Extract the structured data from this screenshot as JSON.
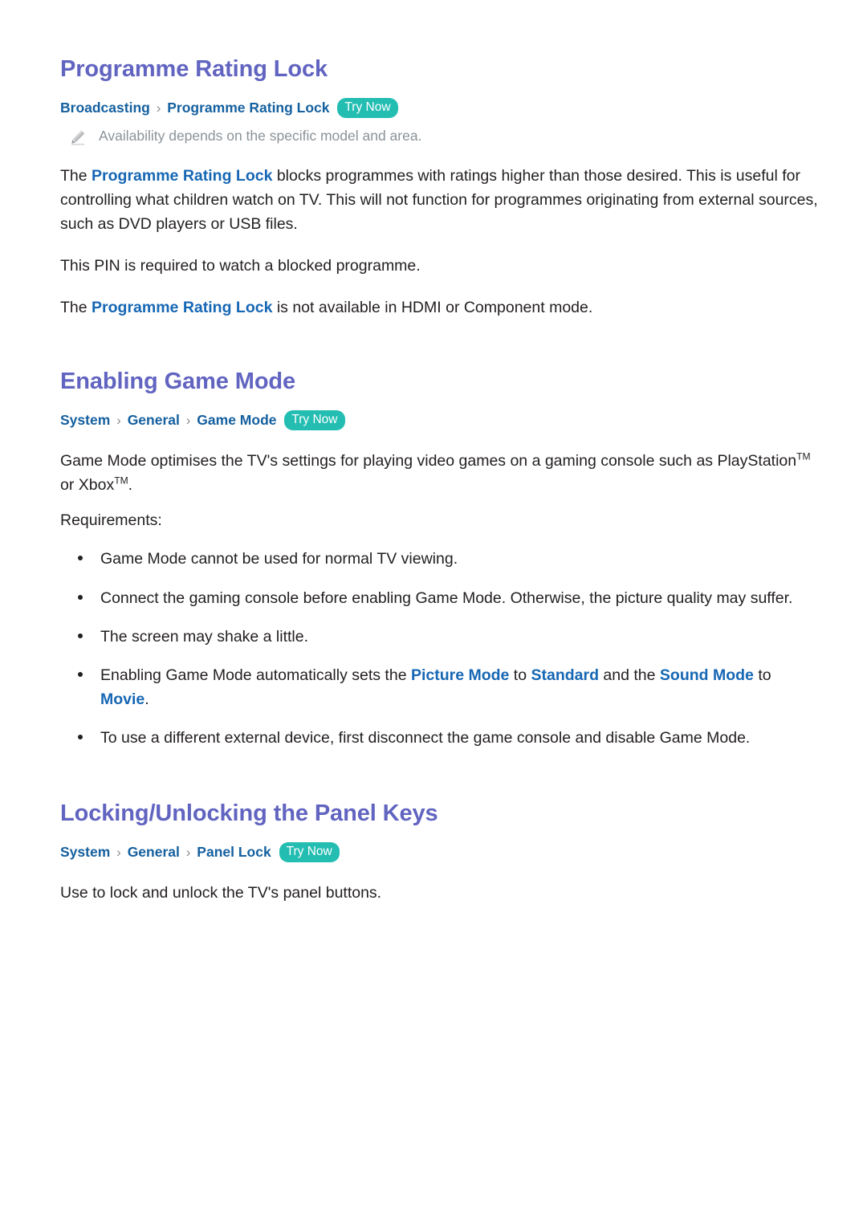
{
  "sections": [
    {
      "title": "Programme Rating Lock",
      "breadcrumb": {
        "crumbs": [
          "Broadcasting",
          "Programme Rating Lock"
        ],
        "separator": "›",
        "try_now_label": "Try Now"
      },
      "note": {
        "icon": "pencil-icon",
        "text": "Availability depends on the specific model and area."
      },
      "paragraphs": [
        {
          "parts": [
            {
              "text": "The ",
              "style": "plain"
            },
            {
              "text": "Programme Rating Lock",
              "style": "link"
            },
            {
              "text": " blocks programmes with ratings higher than those desired. This is useful for controlling what children watch on TV. This will not function for programmes originating from external sources, such as DVD players or USB files.",
              "style": "plain"
            }
          ]
        },
        {
          "parts": [
            {
              "text": "This PIN is required to watch a blocked programme.",
              "style": "plain"
            }
          ]
        },
        {
          "parts": [
            {
              "text": "The ",
              "style": "plain"
            },
            {
              "text": "Programme Rating Lock",
              "style": "link"
            },
            {
              "text": " is not available in HDMI or Component mode.",
              "style": "plain"
            }
          ]
        }
      ]
    },
    {
      "title": "Enabling Game Mode",
      "breadcrumb": {
        "crumbs": [
          "System",
          "General",
          "Game Mode"
        ],
        "separator": "›",
        "try_now_label": "Try Now"
      },
      "paragraphs": [
        {
          "parts": [
            {
              "text": "Game Mode optimises the TV's settings for playing video games on a gaming console such as PlayStation",
              "style": "plain"
            },
            {
              "text": "TM",
              "style": "sup"
            },
            {
              "text": " or Xbox",
              "style": "plain"
            },
            {
              "text": "TM",
              "style": "sup"
            },
            {
              "text": ".",
              "style": "plain"
            }
          ]
        },
        {
          "parts": [
            {
              "text": "Requirements:",
              "style": "plain"
            }
          ]
        }
      ],
      "bullets": [
        {
          "parts": [
            {
              "text": "Game Mode cannot be used for normal TV viewing.",
              "style": "plain"
            }
          ]
        },
        {
          "parts": [
            {
              "text": "Connect the gaming console before enabling Game Mode. Otherwise, the picture quality may suffer.",
              "style": "plain"
            }
          ]
        },
        {
          "parts": [
            {
              "text": "The screen may shake a little.",
              "style": "plain"
            }
          ]
        },
        {
          "parts": [
            {
              "text": "Enabling Game Mode automatically sets the ",
              "style": "plain"
            },
            {
              "text": "Picture Mode",
              "style": "link"
            },
            {
              "text": " to ",
              "style": "plain"
            },
            {
              "text": "Standard",
              "style": "link"
            },
            {
              "text": " and the ",
              "style": "plain"
            },
            {
              "text": "Sound Mode",
              "style": "link"
            },
            {
              "text": " to ",
              "style": "plain"
            },
            {
              "text": "Movie",
              "style": "link"
            },
            {
              "text": ".",
              "style": "plain"
            }
          ]
        },
        {
          "parts": [
            {
              "text": "To use a different external device, first disconnect the game console and disable Game Mode.",
              "style": "plain"
            }
          ]
        }
      ]
    },
    {
      "title": "Locking/Unlocking the Panel Keys",
      "breadcrumb": {
        "crumbs": [
          "System",
          "General",
          "Panel Lock"
        ],
        "separator": "›",
        "try_now_label": "Try Now"
      },
      "paragraphs": [
        {
          "parts": [
            {
              "text": "Use to lock and unlock the TV's panel buttons.",
              "style": "plain"
            }
          ]
        }
      ]
    }
  ],
  "colors": {
    "heading": "#6164c0",
    "breadcrumb_link": "#15609f",
    "inline_link": "#1667b4",
    "try_now_badge": "#23bdb2",
    "note_text": "#8b9298",
    "body_text": "#231f20",
    "page_background": "#ffffff"
  }
}
